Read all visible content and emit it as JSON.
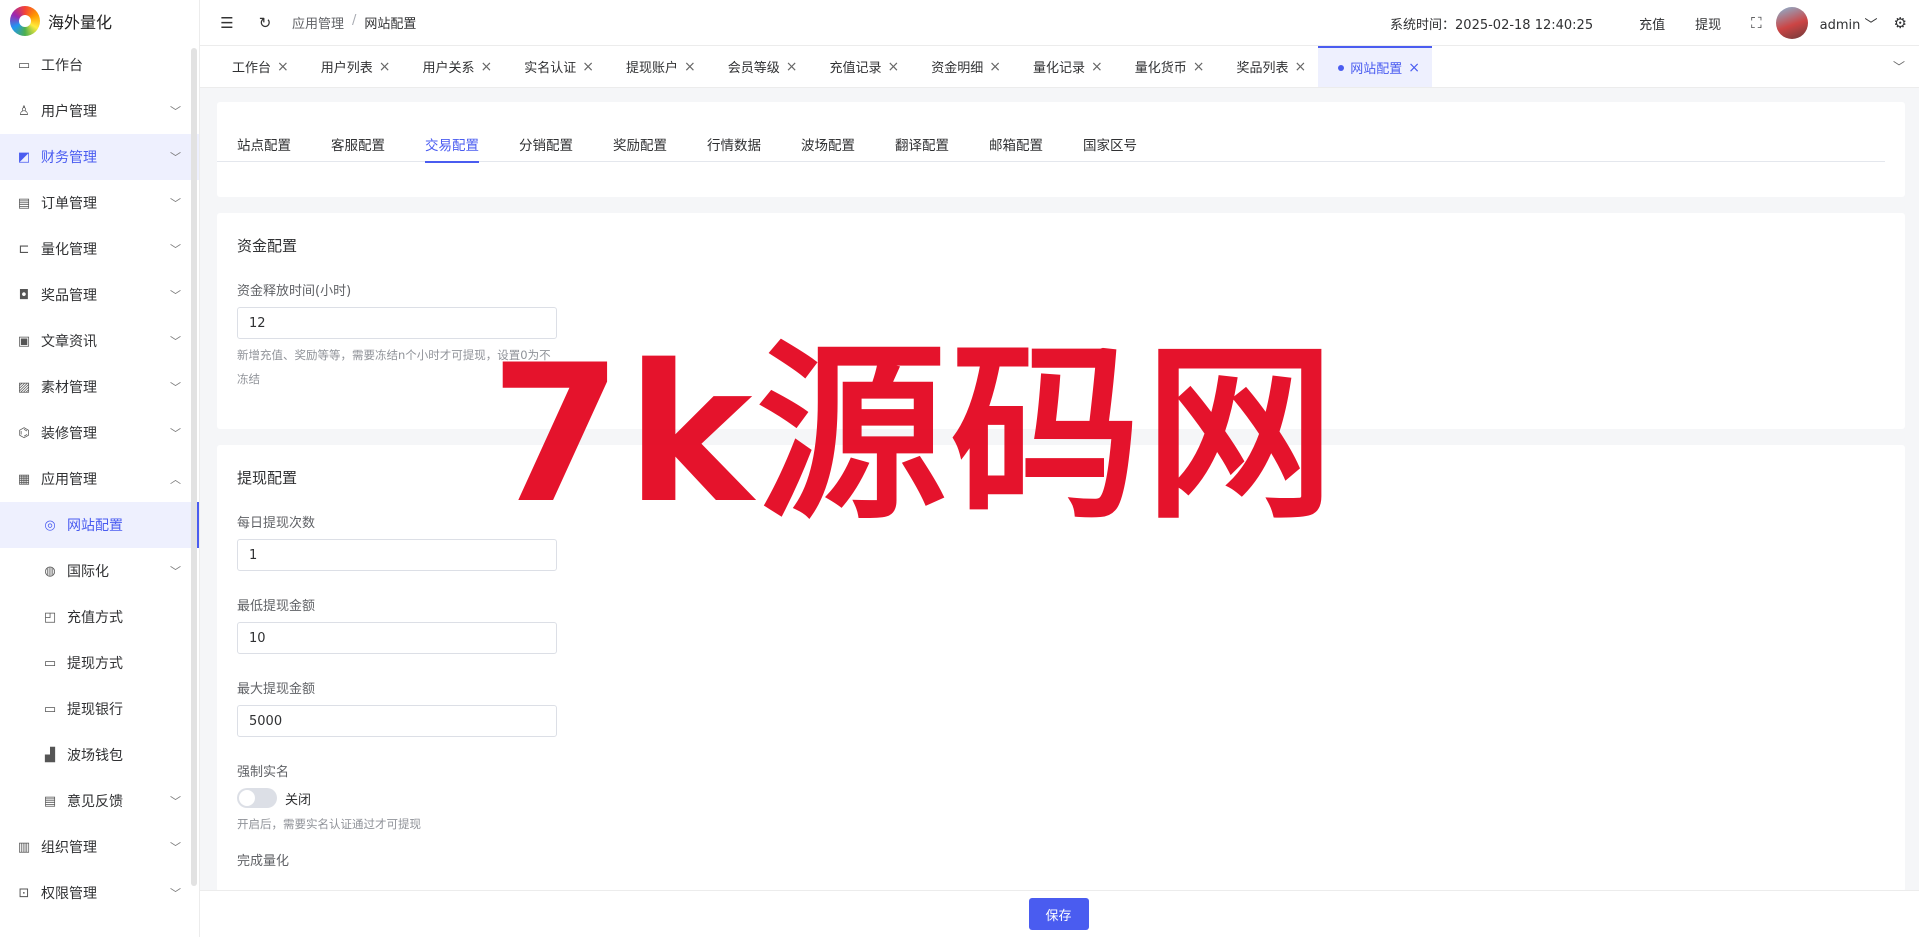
{
  "app": {
    "name": "海外量化"
  },
  "sidebar": {
    "items": [
      {
        "label": "工作台",
        "icon": "monitor-icon",
        "glyph": "▭"
      },
      {
        "label": "用户管理",
        "icon": "user-icon",
        "glyph": "♙"
      },
      {
        "label": "财务管理",
        "icon": "chart-icon",
        "glyph": "◩"
      },
      {
        "label": "订单管理",
        "icon": "order-icon",
        "glyph": "▤"
      },
      {
        "label": "量化管理",
        "icon": "quant-icon",
        "glyph": "⊏"
      },
      {
        "label": "奖品管理",
        "icon": "bag-icon",
        "glyph": "◘"
      },
      {
        "label": "文章资讯",
        "icon": "article-icon",
        "glyph": "▣"
      },
      {
        "label": "素材管理",
        "icon": "image-icon",
        "glyph": "▨"
      },
      {
        "label": "装修管理",
        "icon": "brush-icon",
        "glyph": "⌬"
      },
      {
        "label": "应用管理",
        "icon": "app-icon",
        "glyph": "▦"
      }
    ],
    "subitems": [
      {
        "label": "网站配置",
        "icon": "web-icon",
        "glyph": "◎"
      },
      {
        "label": "国际化",
        "icon": "globe-icon",
        "glyph": "◍"
      },
      {
        "label": "充值方式",
        "icon": "wallet-icon",
        "glyph": "◰"
      },
      {
        "label": "提现方式",
        "icon": "folder-icon",
        "glyph": "▭"
      },
      {
        "label": "提现银行",
        "icon": "card-icon",
        "glyph": "▭"
      },
      {
        "label": "波场钱包",
        "icon": "tron-icon",
        "glyph": "▟"
      },
      {
        "label": "意见反馈",
        "icon": "feedback-icon",
        "glyph": "▤"
      }
    ],
    "bottom_items": [
      {
        "label": "组织管理",
        "icon": "org-icon",
        "glyph": "▥"
      },
      {
        "label": "权限管理",
        "icon": "lock-icon",
        "glyph": "⊡"
      }
    ]
  },
  "header": {
    "breadcrumb": [
      "应用管理",
      "网站配置"
    ],
    "system_time": "系统时间：2025-02-18 12:40:25",
    "recharge": "充值",
    "withdraw": "提现",
    "username": "admin"
  },
  "tabs": [
    "工作台",
    "用户列表",
    "用户关系",
    "实名认证",
    "提现账户",
    "会员等级",
    "充值记录",
    "资金明细",
    "量化记录",
    "量化货币",
    "奖品列表",
    "网站配置"
  ],
  "subtabs": [
    "站点配置",
    "客服配置",
    "交易配置",
    "分销配置",
    "奖励配置",
    "行情数据",
    "波场配置",
    "翻译配置",
    "邮箱配置",
    "国家区号"
  ],
  "fund": {
    "title": "资金配置",
    "release_label": "资金释放时间(小时)",
    "release_value": "12",
    "release_hint": "新增充值、奖励等等，需要冻结n个小时才可提现，设置0为不冻结"
  },
  "withdraw_config": {
    "title": "提现配置",
    "daily_label": "每日提现次数",
    "daily_value": "1",
    "min_label": "最低提现金额",
    "min_value": "10",
    "max_label": "最大提现金额",
    "max_value": "5000",
    "kyc_label": "强制实名",
    "kyc_state": "关闭",
    "kyc_hint": "开启后，需要实名认证通过才可提现",
    "quant_label": "完成量化"
  },
  "footer": {
    "save": "保存"
  },
  "watermark": "7k源码网"
}
